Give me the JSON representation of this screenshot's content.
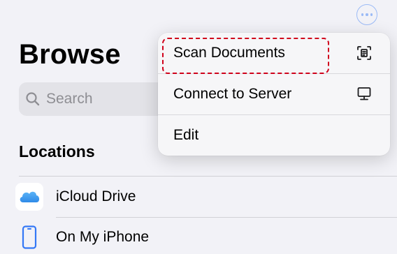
{
  "header": {
    "title": "Browse",
    "more_icon": "ellipsis-circle-icon"
  },
  "search": {
    "placeholder": "Search",
    "icon": "magnifying-glass-icon"
  },
  "locations": {
    "header": "Locations",
    "items": [
      {
        "label": "iCloud Drive",
        "icon": "icloud-icon"
      },
      {
        "label": "On My iPhone",
        "icon": "iphone-icon"
      }
    ]
  },
  "menu": {
    "items": [
      {
        "label": "Scan Documents",
        "icon": "doc-viewfinder-icon",
        "highlighted": true
      },
      {
        "label": "Connect to Server",
        "icon": "desktop-computer-icon"
      },
      {
        "label": "Edit"
      }
    ]
  },
  "colors": {
    "accent": "#3478f6",
    "highlight_border": "#d0021b",
    "background": "#f2f2f7"
  }
}
